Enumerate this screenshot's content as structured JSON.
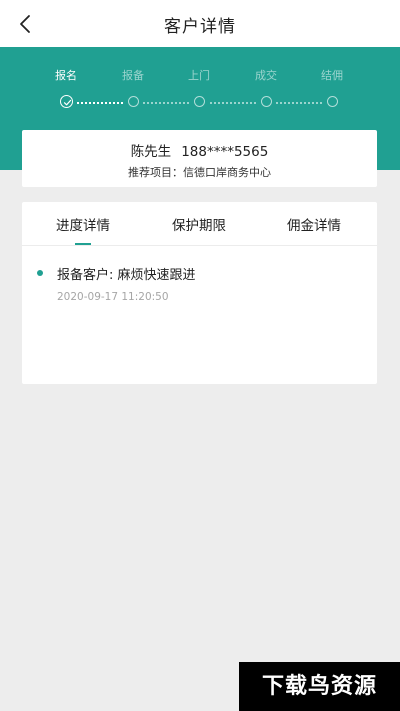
{
  "header": {
    "title": "客户详情"
  },
  "progress_steps": [
    {
      "label": "报名",
      "state": "done"
    },
    {
      "label": "报备",
      "state": "pending"
    },
    {
      "label": "上门",
      "state": "pending"
    },
    {
      "label": "成交",
      "state": "pending"
    },
    {
      "label": "结佣",
      "state": "pending"
    }
  ],
  "customer": {
    "name": "陈先生",
    "phone": "188****5565",
    "project_line": "推荐项目：信德口岸商务中心"
  },
  "tabs": [
    {
      "label": "进度详情",
      "active": true
    },
    {
      "label": "保护期限",
      "active": false
    },
    {
      "label": "佣金详情",
      "active": false
    }
  ],
  "progress_records": [
    {
      "text": "报备客户: 麻烦快速跟进",
      "time": "2020-09-17 11:20:50"
    }
  ],
  "watermark": {
    "text": "下载鸟资源"
  },
  "colors": {
    "accent": "#20a092",
    "background": "#ededed",
    "card": "#ffffff"
  },
  "icons": {
    "back": "chevron-left-icon",
    "step_done": "check-circle-icon",
    "step_pending": "circle-outline-icon"
  }
}
